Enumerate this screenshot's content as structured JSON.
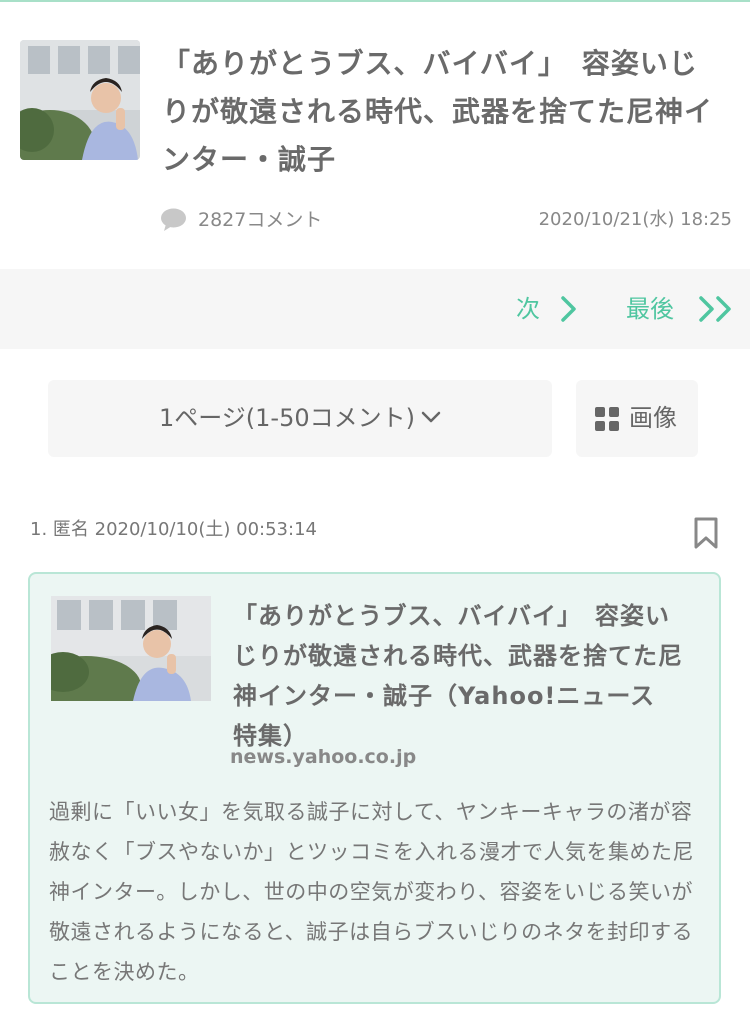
{
  "article": {
    "title": "「ありがとうブス、バイバイ」　容姿いじりが敬遠される時代、武器を捨てた尼神インター・誠子",
    "comment_count": "2827コメント",
    "date": "2020/10/21(水) 18:25"
  },
  "pager": {
    "next_label": "次",
    "last_label": "最後"
  },
  "controls": {
    "page_select_label": "1ページ(1-50コメント)",
    "image_button_label": "画像"
  },
  "comment": {
    "meta": "1. 匿名 2020/10/10(土) 00:53:14",
    "card": {
      "title": "「ありがとうブス、バイバイ」　容姿いじりが敬遠される時代、武器を捨てた尼神インター・誠子（Yahoo!ニュース 特集）",
      "domain": "news.yahoo.co.jp",
      "description": "過剰に「いい女」を気取る誠子に対して、ヤンキーキャラの渚が容赦なく「ブスやないか」とツッコミを入れる漫才で人気を集めた尼神インター。しかし、世の中の空気が変わり、容姿をいじる笑いが敬遠されるようになると、誠子は自らブスいじりのネタを封印することを決めた。"
    }
  },
  "colors": {
    "accent": "#4fc6a0",
    "card_bg": "#ecf6f3",
    "card_border": "#b9e6d6",
    "bar_bg": "#f6f6f6"
  },
  "icons": [
    "comment-bubble-icon",
    "chevron-right-icon",
    "double-chevron-right-icon",
    "chevron-down-icon",
    "grid-icon",
    "bookmark-icon"
  ]
}
